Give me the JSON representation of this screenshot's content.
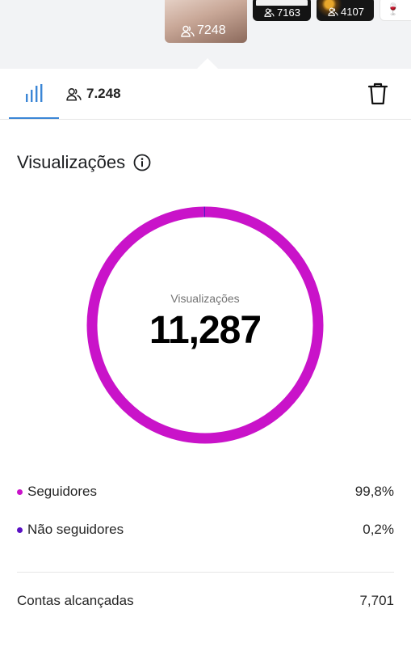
{
  "thumbnails": [
    {
      "count": "7248",
      "active": true
    },
    {
      "count": "7163",
      "active": false
    },
    {
      "count": "4107",
      "active": false
    },
    {
      "count": "",
      "active": false
    }
  ],
  "tabs": {
    "followers_count": "7.248"
  },
  "views": {
    "title": "Visualizações",
    "center_label": "Visualizações",
    "total": "11,287"
  },
  "breakdown": [
    {
      "label": "Seguidores",
      "value": "99,8%",
      "color": "#c913c9",
      "percent": 99.8
    },
    {
      "label": "Não seguidores",
      "value": "0,2%",
      "color": "#5b11c4",
      "percent": 0.2
    }
  ],
  "accounts_reached": {
    "label": "Contas alcançadas",
    "value": "7,701"
  },
  "colors": {
    "accent_blue": "#3b86d6",
    "followers": "#c913c9",
    "non_followers": "#5b11c4"
  }
}
